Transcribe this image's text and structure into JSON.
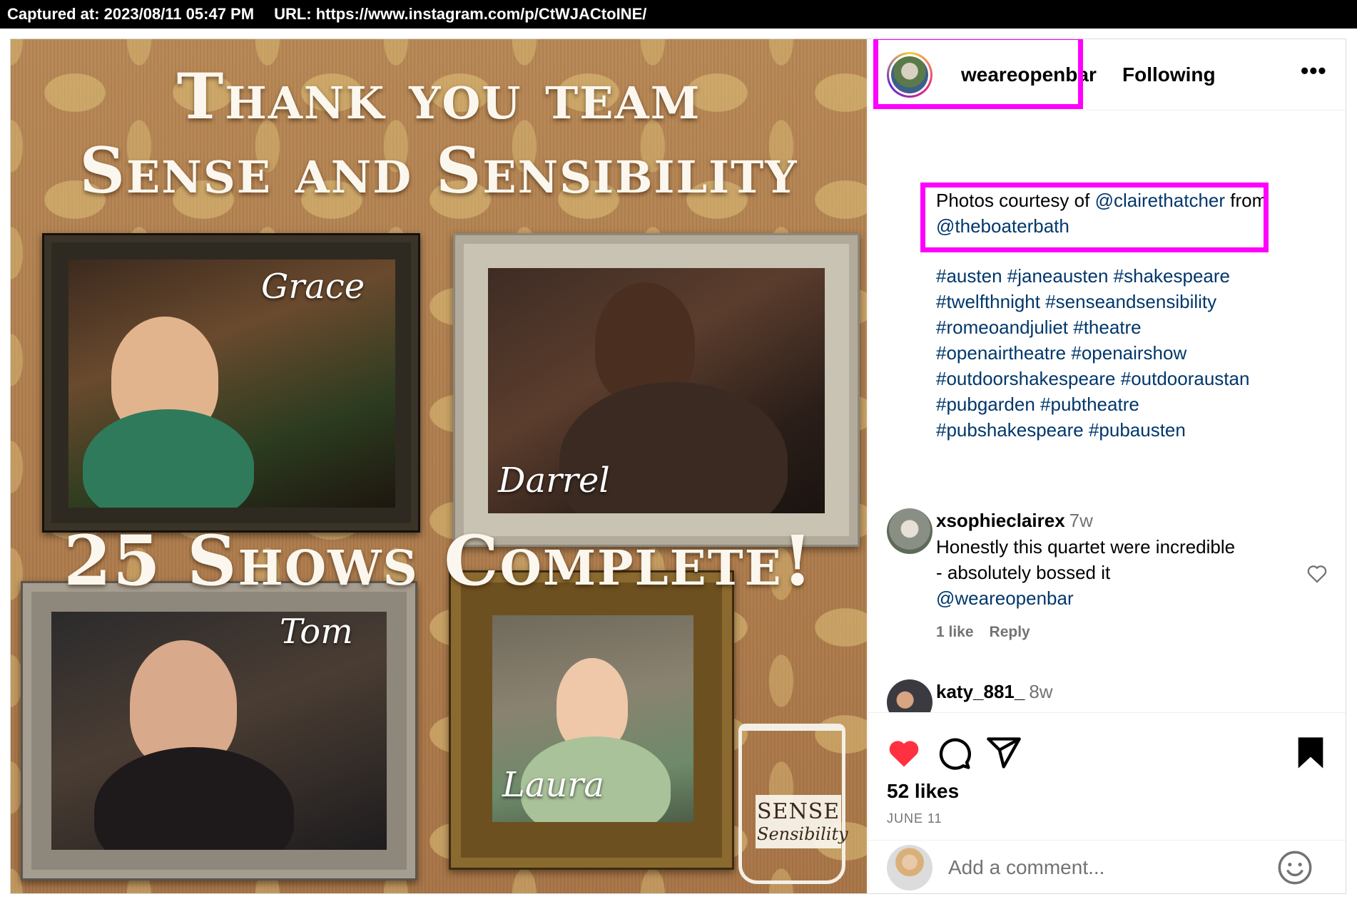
{
  "capture": {
    "captured_at": "Captured at: 2023/08/11 05:47 PM",
    "url": "URL: https://www.instagram.com/p/CtWJACtoINE/"
  },
  "media": {
    "title_line1": "Thank you team",
    "title_line2": "Sense and Sensibility",
    "title_line3": "25 Shows Complete!",
    "names": [
      "Grace",
      "Darrel",
      "Tom",
      "Laura"
    ],
    "logo_line1": "SENSE",
    "logo_line2": "Sensibility"
  },
  "header": {
    "username": "weareopenbar",
    "following": "Following",
    "more": "•••"
  },
  "caption": {
    "prefix": "Photos courtesy of ",
    "mention1": "@clairethatcher",
    "middle": " from",
    "mention2": "@theboaterbath",
    "hashtag_lines": [
      "#austen #janeausten #shakespeare",
      "#twelfthnight #senseandsensibility",
      "#romeoandjuliet #theatre",
      "#openairtheatre #openairshow",
      "#outdoorshakespeare #outdooraustan",
      "#pubgarden #pubtheatre",
      "#pubshakespeare #pubausten"
    ]
  },
  "comments": [
    {
      "username": "xsophieclairex",
      "time": "7w",
      "line1": "Honestly this quartet were incredible",
      "line2": "- absolutely bossed it",
      "mention": "@weareopenbar",
      "likes": "1 like",
      "reply": "Reply"
    },
    {
      "username": "katy_881_",
      "time": "8w"
    }
  ],
  "footer": {
    "likes": "52 likes",
    "date": "JUNE 11",
    "comment_placeholder": "Add a comment..."
  },
  "colors": {
    "link": "#00376b",
    "highlight": "#ff00ff",
    "like_red": "#ff3040",
    "muted": "#737373"
  }
}
